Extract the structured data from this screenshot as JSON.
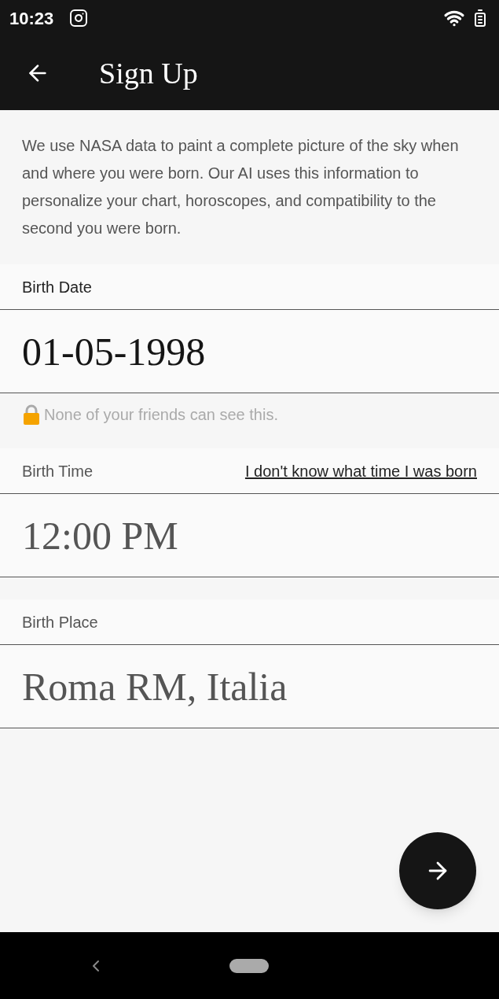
{
  "status_bar": {
    "time": "10:23"
  },
  "app_bar": {
    "title": "Sign Up"
  },
  "intro": "We use NASA data to paint a complete picture of the sky when and where you were born. Our AI uses this information to personalize your chart, horoscopes, and compatibility to the second you were born.",
  "fields": [
    {
      "label": "Birth Date",
      "value": "01-05-1998",
      "note": "None of your friends can see this."
    },
    {
      "label": "Birth Time",
      "link": "I don't know what time I was born",
      "placeholder": "12:00 PM"
    },
    {
      "label": "Birth Place",
      "placeholder": "Roma RM, Italia"
    }
  ]
}
